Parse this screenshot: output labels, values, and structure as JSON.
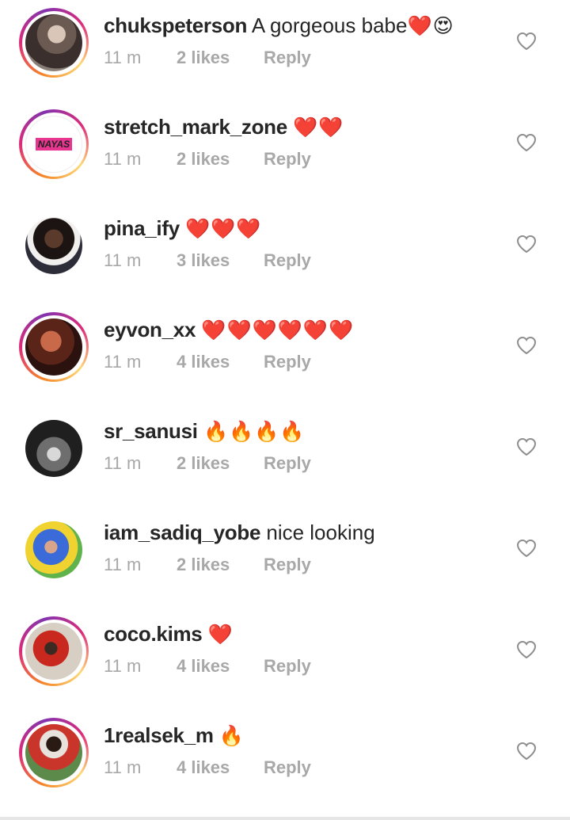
{
  "colors": {
    "heart": "#e0152b",
    "fire": "#f5800b",
    "meta": "#a8a8a8",
    "text": "#262626"
  },
  "comments": [
    {
      "username": "chukspeterson",
      "text": "A gorgeous babe",
      "emojis": "❤️😍",
      "time": "11 m",
      "likes": "2 likes",
      "reply": "Reply",
      "story_ring": true,
      "avatar_label": ""
    },
    {
      "username": "stretch_mark_zone",
      "text": "",
      "emojis": "❤️❤️",
      "time": "11 m",
      "likes": "2 likes",
      "reply": "Reply",
      "story_ring": true,
      "avatar_label": "NAYAS"
    },
    {
      "username": "pina_ify",
      "text": "",
      "emojis": "❤️❤️❤️",
      "time": "11 m",
      "likes": "3 likes",
      "reply": "Reply",
      "story_ring": false,
      "avatar_label": ""
    },
    {
      "username": "eyvon_xx",
      "text": "",
      "emojis": "❤️❤️❤️❤️❤️❤️",
      "time": "11 m",
      "likes": "4 likes",
      "reply": "Reply",
      "story_ring": true,
      "avatar_label": ""
    },
    {
      "username": "sr_sanusi",
      "text": "",
      "emojis": "🔥🔥🔥🔥",
      "time": "11 m",
      "likes": "2 likes",
      "reply": "Reply",
      "story_ring": false,
      "avatar_label": ""
    },
    {
      "username": "iam_sadiq_yobe",
      "text": "nice looking",
      "emojis": "",
      "time": "11 m",
      "likes": "2 likes",
      "reply": "Reply",
      "story_ring": false,
      "avatar_label": ""
    },
    {
      "username": "coco.kims",
      "text": "",
      "emojis": "❤️",
      "time": "11 m",
      "likes": "4 likes",
      "reply": "Reply",
      "story_ring": true,
      "avatar_label": ""
    },
    {
      "username": "1realsek_m",
      "text": "",
      "emojis": "🔥",
      "time": "11 m",
      "likes": "4 likes",
      "reply": "Reply",
      "story_ring": true,
      "avatar_label": ""
    }
  ]
}
